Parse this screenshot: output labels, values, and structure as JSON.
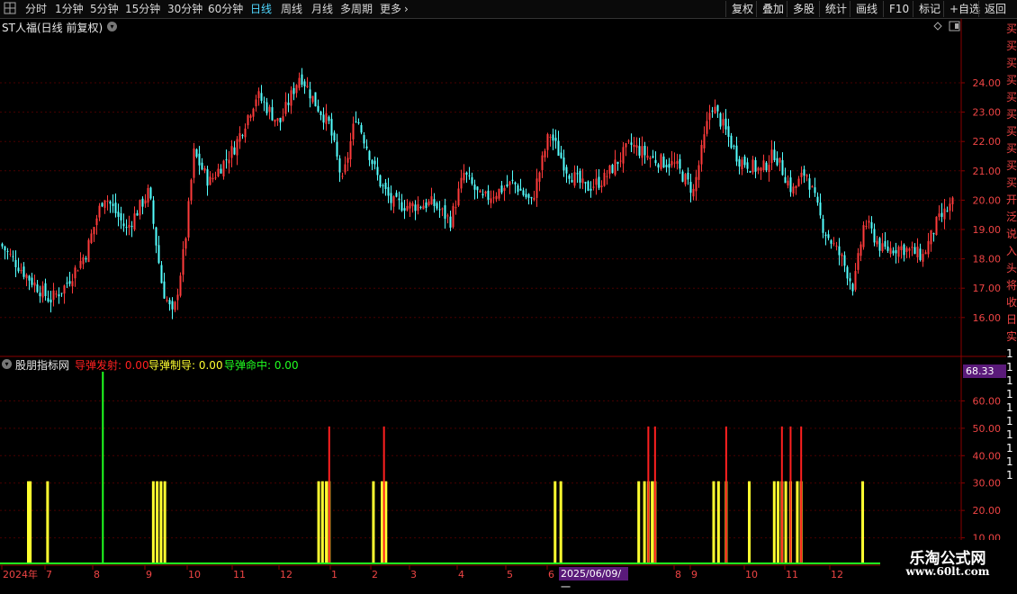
{
  "toolbar": {
    "periods": [
      {
        "label": "分时",
        "active": false
      },
      {
        "label": "1分钟",
        "active": false
      },
      {
        "label": "5分钟",
        "active": false
      },
      {
        "label": "15分钟",
        "active": false
      },
      {
        "label": "30分钟",
        "active": false
      },
      {
        "label": "60分钟",
        "active": false
      },
      {
        "label": "日线",
        "active": true
      },
      {
        "label": "周线",
        "active": false
      },
      {
        "label": "月线",
        "active": false
      },
      {
        "label": "多周期",
        "active": false
      },
      {
        "label": "更多",
        "active": false
      }
    ],
    "right_buttons": [
      "复权",
      "叠加",
      "多股",
      "统计",
      "画线",
      "F10",
      "标记",
      "+自选",
      "返回"
    ]
  },
  "main_chart": {
    "title": "ST人福(日线 前复权)",
    "y_ticks": [
      "24.00",
      "23.00",
      "22.00",
      "21.00",
      "20.00",
      "19.00",
      "18.00",
      "17.00",
      "16.00"
    ],
    "colors": {
      "up": "#ff3b3b",
      "down": "#54ffff",
      "grid": "#4a0000",
      "axis": "#8a0000"
    }
  },
  "indicator": {
    "name": "股朋指标网",
    "legend": [
      {
        "label": "导弹发射: 0.00",
        "color": "#ff2020"
      },
      {
        "label": "导弹制导: 0.00",
        "color": "#ffff30"
      },
      {
        "label": "导弹命中: 0.00",
        "color": "#20ff20"
      }
    ],
    "current_value": "68.33",
    "y_ticks": [
      "60.00",
      "50.00",
      "40.00",
      "30.00",
      "20.00",
      "10.00"
    ]
  },
  "chart_data": {
    "type": "bar",
    "title": "股朋指标网",
    "x_axis_labels": [
      "2024年",
      "7",
      "8",
      "9",
      "10",
      "11",
      "12",
      "1",
      "2",
      "3",
      "4",
      "5",
      "6",
      "2025/06/09/一",
      "8",
      "9",
      "10",
      "11",
      "12"
    ],
    "ylim": [
      0,
      70
    ],
    "series": [
      {
        "name": "导弹发射",
        "color": "#ff2020",
        "bars": [
          {
            "x": 0.3425,
            "value": 50
          },
          {
            "x": 0.3995,
            "value": 50
          },
          {
            "x": 0.6745,
            "value": 50
          },
          {
            "x": 0.6815,
            "value": 50
          },
          {
            "x": 0.7555,
            "value": 50
          },
          {
            "x": 0.8135,
            "value": 50
          },
          {
            "x": 0.8225,
            "value": 50
          },
          {
            "x": 0.8335,
            "value": 50
          }
        ]
      },
      {
        "name": "导弹制导",
        "color": "#ffff30",
        "bars": [
          {
            "x": 0.0295,
            "value": 30
          },
          {
            "x": 0.0315,
            "value": 30
          },
          {
            "x": 0.0495,
            "value": 30
          },
          {
            "x": 0.1595,
            "value": 30
          },
          {
            "x": 0.1635,
            "value": 30
          },
          {
            "x": 0.1675,
            "value": 30
          },
          {
            "x": 0.1715,
            "value": 30
          },
          {
            "x": 0.3315,
            "value": 30
          },
          {
            "x": 0.3355,
            "value": 30
          },
          {
            "x": 0.3395,
            "value": 30
          },
          {
            "x": 0.3425,
            "value": 30
          },
          {
            "x": 0.3885,
            "value": 30
          },
          {
            "x": 0.3975,
            "value": 30
          },
          {
            "x": 0.4015,
            "value": 30
          },
          {
            "x": 0.5775,
            "value": 30
          },
          {
            "x": 0.5835,
            "value": 30
          },
          {
            "x": 0.6645,
            "value": 30
          },
          {
            "x": 0.6705,
            "value": 30
          },
          {
            "x": 0.6745,
            "value": 30
          },
          {
            "x": 0.6785,
            "value": 30
          },
          {
            "x": 0.6815,
            "value": 30
          },
          {
            "x": 0.7425,
            "value": 30
          },
          {
            "x": 0.7475,
            "value": 30
          },
          {
            "x": 0.7555,
            "value": 30
          },
          {
            "x": 0.7795,
            "value": 30
          },
          {
            "x": 0.8055,
            "value": 30
          },
          {
            "x": 0.8095,
            "value": 30
          },
          {
            "x": 0.8135,
            "value": 30
          },
          {
            "x": 0.8175,
            "value": 30
          },
          {
            "x": 0.8225,
            "value": 30
          },
          {
            "x": 0.8295,
            "value": 30
          },
          {
            "x": 0.8335,
            "value": 30
          },
          {
            "x": 0.8975,
            "value": 30
          }
        ]
      },
      {
        "name": "导弹命中",
        "color": "#20ff20",
        "bars": [
          {
            "x": 0.107,
            "value": 70
          }
        ]
      }
    ]
  },
  "watermark": {
    "title": "乐淘公式网",
    "url": "www.60lt.com"
  },
  "right_strip_text": [
    "买",
    "买",
    "买",
    "买",
    "买",
    "买",
    "买",
    "买",
    "买",
    "买",
    "开",
    "泛",
    "说",
    "入",
    "头",
    "将",
    "收",
    "日",
    "实",
    "1",
    "1",
    "1",
    "1",
    "1",
    "1",
    "1",
    "1",
    "1",
    "1"
  ]
}
